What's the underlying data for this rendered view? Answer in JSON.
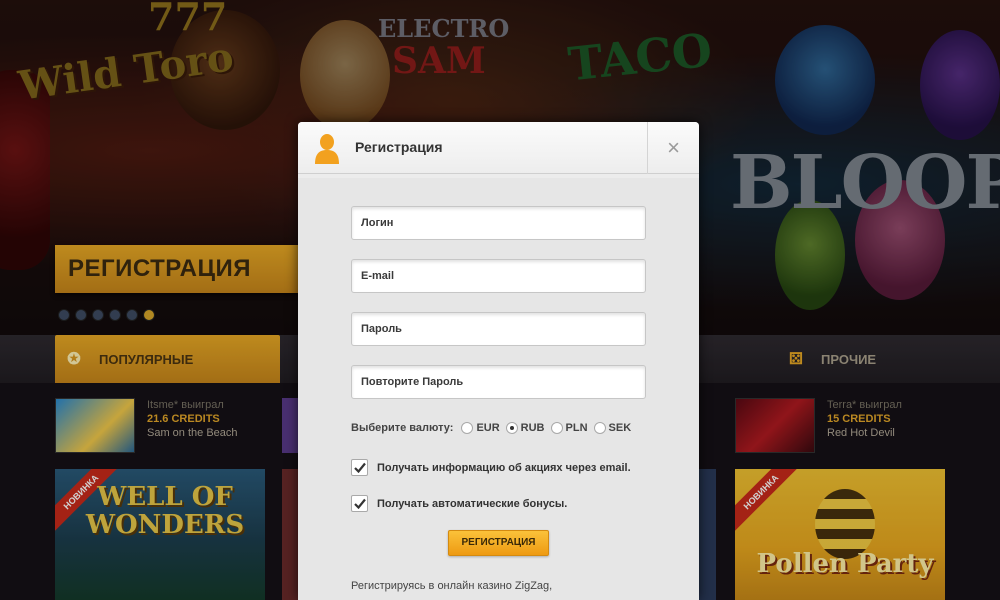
{
  "background": {
    "hero_logos": {
      "brand": "777",
      "wild_toro": "Wild Toro",
      "electro": "ELECTRO",
      "sam": "SAM",
      "taco": "TACO",
      "bloopers": "BLOOPE"
    },
    "hero_banner": "РЕГИСТРАЦИЯ",
    "slider_dots": 6,
    "tabs": {
      "popular": "ПОПУЛЯРНЫЕ",
      "other": "ПРОЧИЕ"
    },
    "winners": [
      {
        "who": "Itsme* выиграл",
        "amount": "21.6 CREDITS",
        "game": "Sam on the Beach"
      },
      {
        "who": "Terra* выиграл",
        "amount": "15 CREDITS",
        "game": "Red Hot Devil"
      }
    ],
    "games": {
      "left_title": "WELL OF WONDERS",
      "right_title": "Pollen Party",
      "badge": "НОВИНКА"
    }
  },
  "modal": {
    "title": "Регистрация",
    "close": "×",
    "fields": {
      "login_placeholder": "Логин",
      "email_placeholder": "E-mail",
      "password_placeholder": "Пароль",
      "repeat_placeholder": "Повторите Пароль"
    },
    "currency": {
      "label": "Выберите валюту:",
      "options": [
        "EUR",
        "RUB",
        "PLN",
        "SEK"
      ],
      "selected": "RUB"
    },
    "checkboxes": {
      "promo_email": "Получать информацию об акциях через email.",
      "auto_bonuses": "Получать автоматические бонусы."
    },
    "submit": "РЕГИСТРАЦИЯ",
    "legal": "Регистрируясь в онлайн казино ZigZag,"
  },
  "colors": {
    "accent": "#e8a925",
    "modal_bg": "#ececec"
  }
}
